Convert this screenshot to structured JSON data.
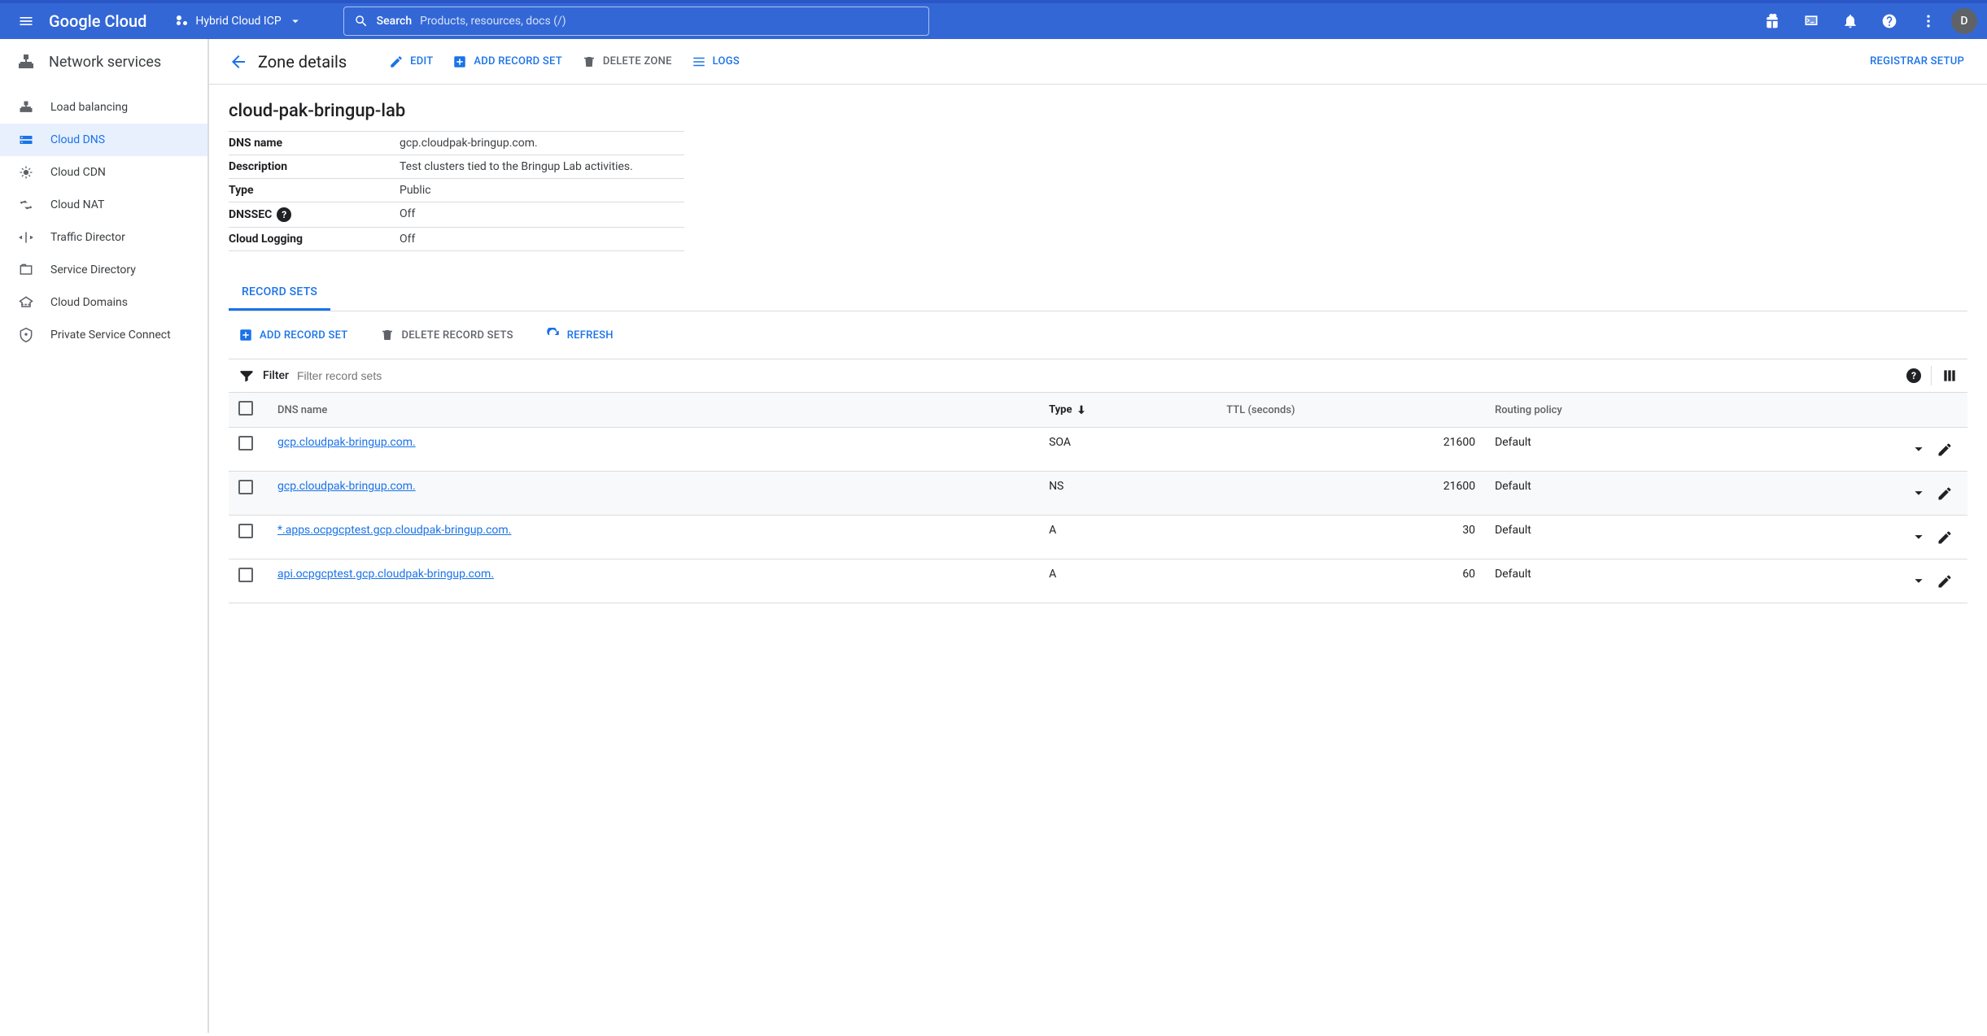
{
  "topbar": {
    "brand": "Google Cloud",
    "project": "Hybrid Cloud ICP",
    "search_label": "Search",
    "search_placeholder": "Products, resources, docs (/)",
    "avatar_initial": "D"
  },
  "sidebar": {
    "title": "Network services",
    "items": [
      {
        "label": "Load balancing",
        "icon": "load-balancing-icon",
        "active": false
      },
      {
        "label": "Cloud DNS",
        "icon": "cloud-dns-icon",
        "active": true
      },
      {
        "label": "Cloud CDN",
        "icon": "cloud-cdn-icon",
        "active": false
      },
      {
        "label": "Cloud NAT",
        "icon": "cloud-nat-icon",
        "active": false
      },
      {
        "label": "Traffic Director",
        "icon": "traffic-director-icon",
        "active": false
      },
      {
        "label": "Service Directory",
        "icon": "service-directory-icon",
        "active": false
      },
      {
        "label": "Cloud Domains",
        "icon": "cloud-domains-icon",
        "active": false
      },
      {
        "label": "Private Service Connect",
        "icon": "private-service-connect-icon",
        "active": false
      }
    ]
  },
  "action_bar": {
    "title": "Zone details",
    "edit": "EDIT",
    "add_record_set": "ADD RECORD SET",
    "delete_zone": "DELETE ZONE",
    "logs": "LOGS",
    "registrar_setup": "REGISTRAR SETUP"
  },
  "zone": {
    "name_heading": "cloud-pak-bringup-lab",
    "meta": {
      "dns_name_label": "DNS name",
      "dns_name_value": "gcp.cloudpak-bringup.com.",
      "description_label": "Description",
      "description_value": "Test clusters tied to the Bringup Lab activities.",
      "type_label": "Type",
      "type_value": "Public",
      "dnssec_label": "DNSSEC",
      "dnssec_value": "Off",
      "logging_label": "Cloud Logging",
      "logging_value": "Off"
    }
  },
  "tabs": {
    "record_sets": "RECORD SETS"
  },
  "toolbar": {
    "add_record_set": "ADD RECORD SET",
    "delete_record_sets": "DELETE RECORD SETS",
    "refresh": "REFRESH"
  },
  "filter": {
    "label": "Filter",
    "placeholder": "Filter record sets"
  },
  "table": {
    "headers": {
      "dns_name": "DNS name",
      "type": "Type",
      "ttl": "TTL (seconds)",
      "routing_policy": "Routing policy"
    },
    "rows": [
      {
        "dns_name": "gcp.cloudpak-bringup.com.",
        "type": "SOA",
        "ttl": "21600",
        "routing_policy": "Default"
      },
      {
        "dns_name": "gcp.cloudpak-bringup.com.",
        "type": "NS",
        "ttl": "21600",
        "routing_policy": "Default"
      },
      {
        "dns_name": "*.apps.ocpgcptest.gcp.cloudpak-bringup.com.",
        "type": "A",
        "ttl": "30",
        "routing_policy": "Default"
      },
      {
        "dns_name": "api.ocpgcptest.gcp.cloudpak-bringup.com.",
        "type": "A",
        "ttl": "60",
        "routing_policy": "Default"
      }
    ]
  }
}
